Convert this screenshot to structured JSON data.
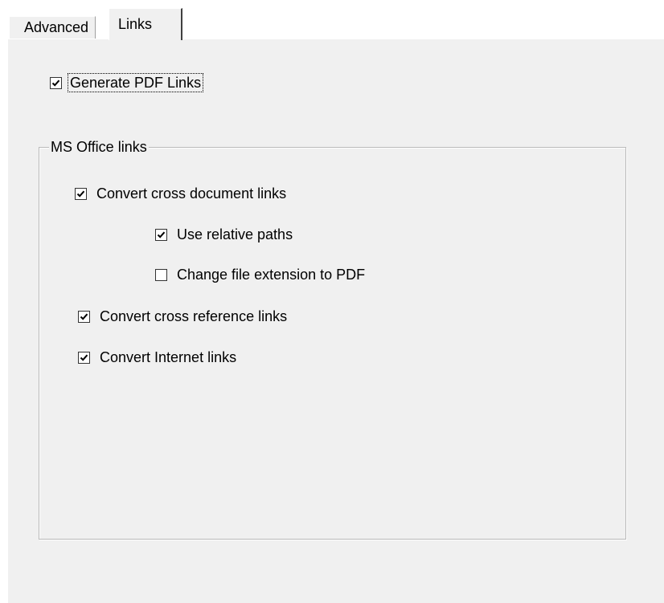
{
  "tabs": {
    "advanced": "Advanced",
    "links": "Links"
  },
  "generate_pdf_links": {
    "label": "Generate PDF Links",
    "checked": true
  },
  "ms_office_group": {
    "title": "MS Office links",
    "items": {
      "convert_cross_document": {
        "label": "Convert cross document links",
        "checked": true
      },
      "use_relative_paths": {
        "label": "Use relative paths",
        "checked": true
      },
      "change_file_extension": {
        "label": "Change file extension to PDF",
        "checked": false
      },
      "convert_cross_reference": {
        "label": "Convert cross reference links",
        "checked": true
      },
      "convert_internet": {
        "label": "Convert Internet links",
        "checked": true
      }
    }
  },
  "colors": {
    "panel_bg": "#f0f0f0",
    "window_bg": "#ffffff",
    "group_border": "#b9b9b9",
    "check_mark": "#000000"
  },
  "icons": {
    "check": "check-mark-icon"
  }
}
